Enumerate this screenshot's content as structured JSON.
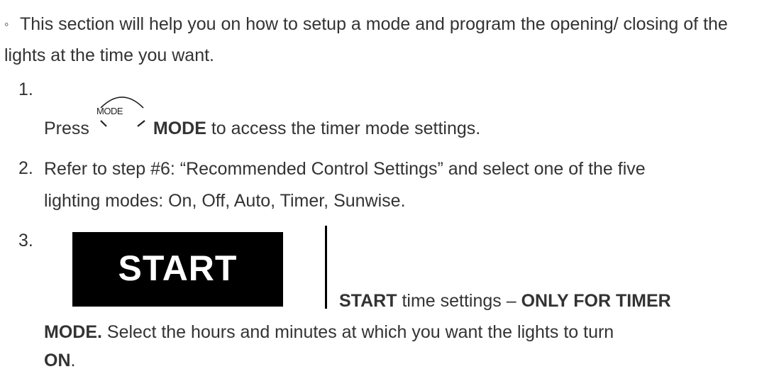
{
  "intro": {
    "bullet": "◦",
    "text": "This section will help you on how to setup a mode and program the opening/ closing of the lights at the time you want."
  },
  "steps": [
    {
      "number": "1.",
      "icon": "mode-button-icon",
      "icon_label": "MODE",
      "prefix": "Press",
      "bold": "MODE",
      "suffix": "to access the timer mode settings."
    },
    {
      "number": "2.",
      "line1": "Refer to step #6: “Recommended Control Settings” and select one of the five",
      "line2": "lighting modes: On, Off, Auto, Timer, Sunwise."
    },
    {
      "number": "3.",
      "image_text": "START",
      "bold1": "START",
      "text1": "time settings –",
      "bold2": "ONLY FOR TIMER",
      "bold3": "MODE.",
      "text2": "Select the hours and minutes at which you want the lights to turn",
      "bold4": "ON",
      "text3": "."
    }
  ]
}
